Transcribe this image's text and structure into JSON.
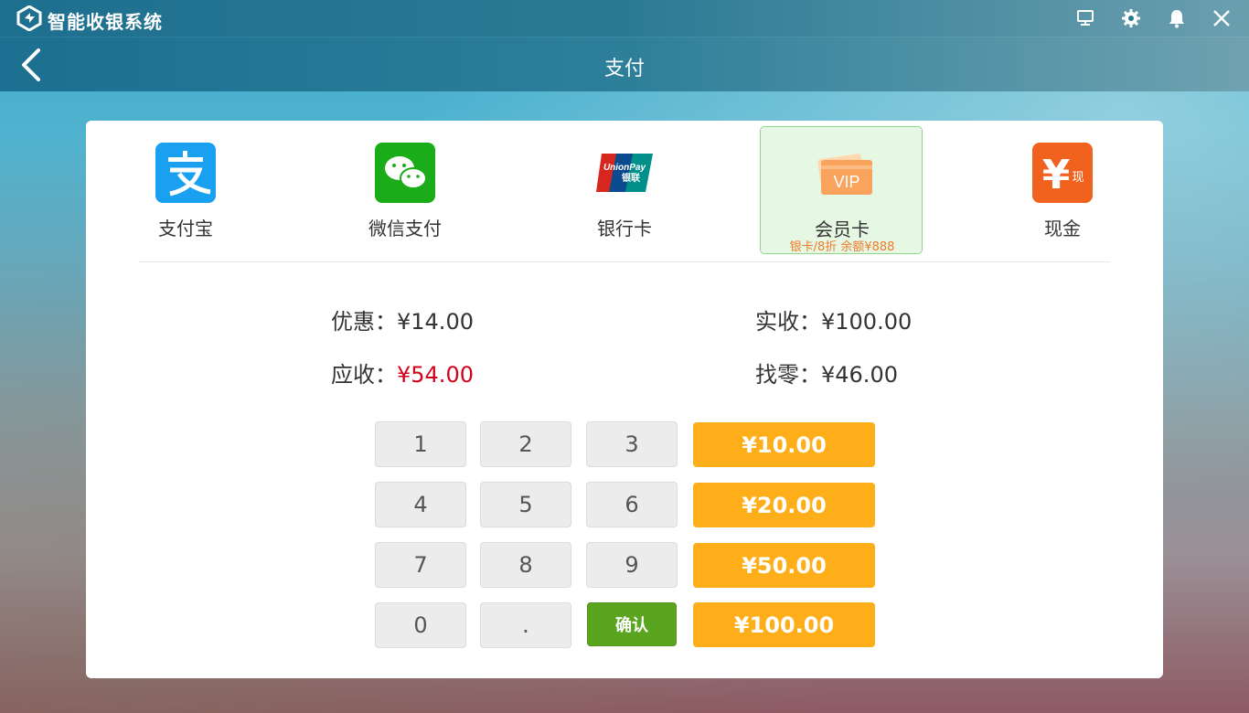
{
  "app": {
    "title": "智能收银系统"
  },
  "titlebar": {
    "icons": [
      "monitor-icon",
      "gear-icon",
      "bell-icon",
      "close-icon"
    ]
  },
  "nav": {
    "title": "支付"
  },
  "methods": [
    {
      "label": "支付宝",
      "icon": "alipay-icon"
    },
    {
      "label": "微信支付",
      "icon": "wechat-pay-icon"
    },
    {
      "label": "银行卡",
      "icon": "unionpay-icon",
      "logo_text_top": "UnionPay",
      "logo_text_bottom": "银联"
    },
    {
      "label": "会员卡",
      "icon": "vip-card-icon",
      "sub": "银卡/8折  余额¥888",
      "selected": true,
      "logo_text": "VIP"
    },
    {
      "label": "现金",
      "icon": "cash-icon",
      "logo_text": "¥",
      "logo_text_small": "现"
    }
  ],
  "summary": {
    "discount_label": "优惠：",
    "discount_value": "¥14.00",
    "received_label": "实收：",
    "received_value": "¥100.00",
    "due_label": "应收：",
    "due_value": "¥54.00",
    "change_label": "找零：",
    "change_value": "¥46.00"
  },
  "keypad": {
    "keys": [
      "1",
      "2",
      "3",
      "4",
      "5",
      "6",
      "7",
      "8",
      "9",
      "0",
      "."
    ],
    "confirm": "确认",
    "quick_amounts": [
      "¥10.00",
      "¥20.00",
      "¥50.00",
      "¥100.00"
    ]
  },
  "colors": {
    "accent_orange": "#fdae19",
    "confirm_green": "#5aa520",
    "due_red": "#d0021b",
    "selected_bg": "#e6f8e4"
  }
}
